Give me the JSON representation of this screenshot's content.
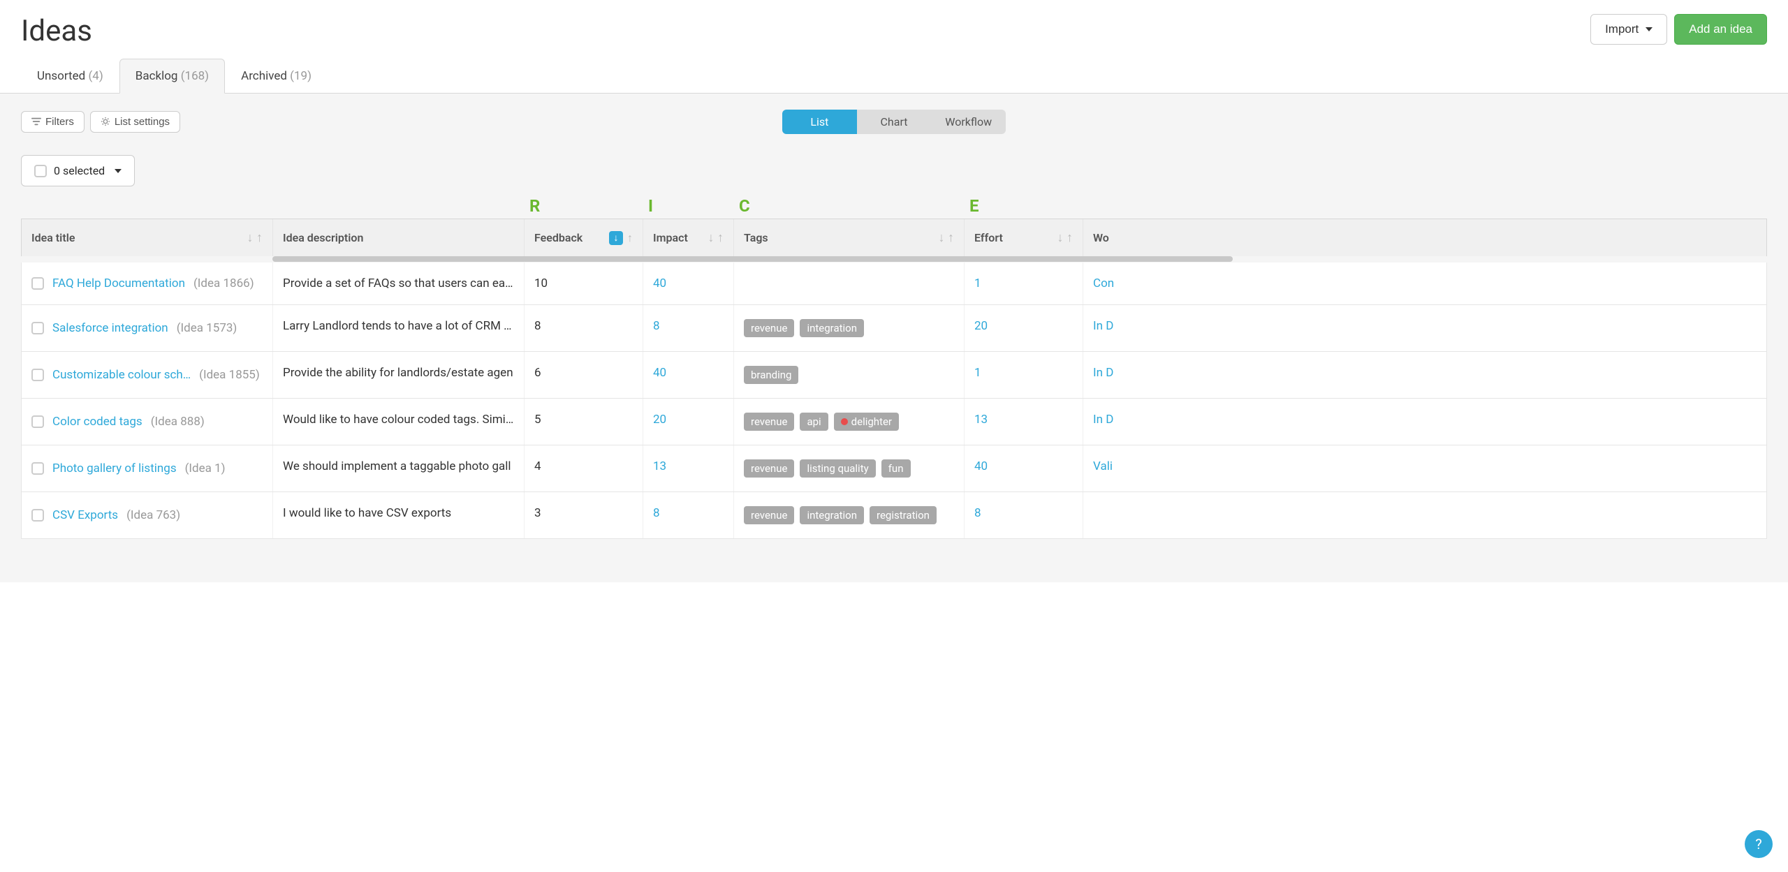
{
  "page": {
    "title": "Ideas"
  },
  "header_actions": {
    "import": "Import",
    "add": "Add an idea"
  },
  "tabs": {
    "unsorted": {
      "label": "Unsorted",
      "count": "(4)"
    },
    "backlog": {
      "label": "Backlog",
      "count": "(168)"
    },
    "archived": {
      "label": "Archived",
      "count": "(19)"
    }
  },
  "tools": {
    "filters": "Filters",
    "list_settings": "List settings"
  },
  "view_toggle": {
    "list": "List",
    "chart": "Chart",
    "workflow": "Workflow"
  },
  "selection": {
    "label": "0 selected"
  },
  "rice": {
    "r": "R",
    "i": "I",
    "c": "C",
    "e": "E"
  },
  "columns": {
    "title": "Idea title",
    "description": "Idea description",
    "feedback": "Feedback",
    "impact": "Impact",
    "tags": "Tags",
    "effort": "Effort",
    "workflow": "Wo"
  },
  "rows": [
    {
      "title": "FAQ Help Documentation",
      "id": "(Idea 1866)",
      "description": "Provide a set of FAQs so that users can easil",
      "feedback": "10",
      "impact": "40",
      "tags": [],
      "effort": "1",
      "workflow": "Con"
    },
    {
      "title": "Salesforce integration",
      "id": "(Idea 1573)",
      "description": "Larry Landlord tends to have a lot of CRM da",
      "feedback": "8",
      "impact": "8",
      "tags": [
        {
          "label": "revenue"
        },
        {
          "label": "integration"
        }
      ],
      "effort": "20",
      "workflow": "In D"
    },
    {
      "title": "Customizable colour sch…",
      "id": "(Idea 1855)",
      "description": "Provide the ability for landlords/estate agen",
      "feedback": "6",
      "impact": "40",
      "tags": [
        {
          "label": "branding"
        }
      ],
      "effort": "1",
      "workflow": "In D"
    },
    {
      "title": "Color coded tags",
      "id": "(Idea 888)",
      "description": "Would like to have colour coded tags. Simila",
      "feedback": "5",
      "impact": "20",
      "tags": [
        {
          "label": "revenue"
        },
        {
          "label": "api"
        },
        {
          "label": "delighter",
          "dot": true
        }
      ],
      "effort": "13",
      "workflow": "In D"
    },
    {
      "title": "Photo gallery of listings",
      "id": "(Idea 1)",
      "description": "We should implement a taggable photo gall",
      "feedback": "4",
      "impact": "13",
      "tags": [
        {
          "label": "revenue"
        },
        {
          "label": "listing quality"
        },
        {
          "label": "fun"
        }
      ],
      "effort": "40",
      "workflow": "Vali"
    },
    {
      "title": "CSV Exports",
      "id": "(Idea 763)",
      "description": "I would like to have CSV exports",
      "feedback": "3",
      "impact": "8",
      "tags": [
        {
          "label": "revenue"
        },
        {
          "label": "integration"
        },
        {
          "label": "registration"
        }
      ],
      "effort": "8",
      "workflow": ""
    }
  ],
  "help_label": "?"
}
